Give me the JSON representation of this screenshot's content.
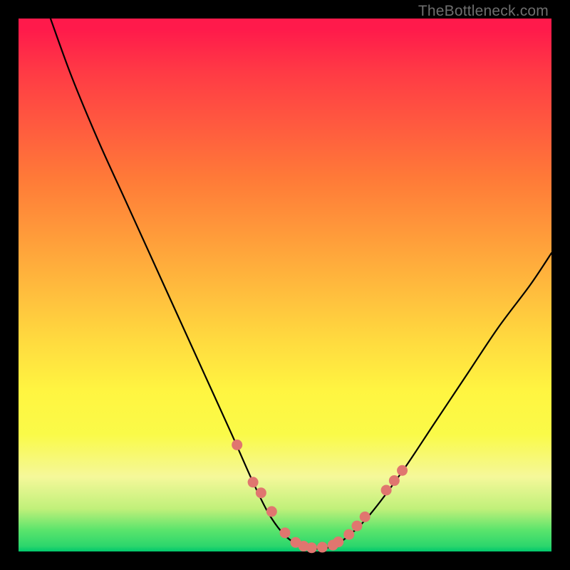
{
  "watermark": "TheBottleneck.com",
  "chart_data": {
    "type": "line",
    "title": "",
    "xlabel": "",
    "ylabel": "",
    "xlim": [
      0,
      100
    ],
    "ylim": [
      0,
      100
    ],
    "grid": false,
    "legend": false,
    "series": [
      {
        "name": "curve",
        "x": [
          6,
          10,
          15,
          20,
          25,
          30,
          35,
          40,
          44,
          47,
          50,
          53,
          56,
          59,
          62,
          66,
          72,
          78,
          84,
          90,
          96,
          100
        ],
        "y": [
          100,
          89,
          77,
          66,
          55,
          44,
          33,
          22,
          13,
          7,
          3,
          1,
          0.5,
          1,
          3,
          7,
          15,
          24,
          33,
          42,
          50,
          56
        ]
      }
    ],
    "annotations_dots": {
      "name": "highlight-dots",
      "color": "#e0766f",
      "x": [
        41,
        44,
        45.5,
        47.5,
        50,
        52,
        53.5,
        55,
        57,
        59,
        60,
        62,
        63.5,
        65,
        69,
        70.5,
        72
      ],
      "y": [
        20,
        13,
        11,
        7.5,
        3.5,
        1.7,
        1.0,
        0.7,
        0.8,
        1.2,
        1.8,
        3.2,
        4.8,
        6.5,
        11.5,
        13.3,
        15.2
      ]
    },
    "background_gradient": {
      "top": "#ff1a4b",
      "mid": "#ffe13f",
      "bottom": "#00c86c"
    }
  }
}
